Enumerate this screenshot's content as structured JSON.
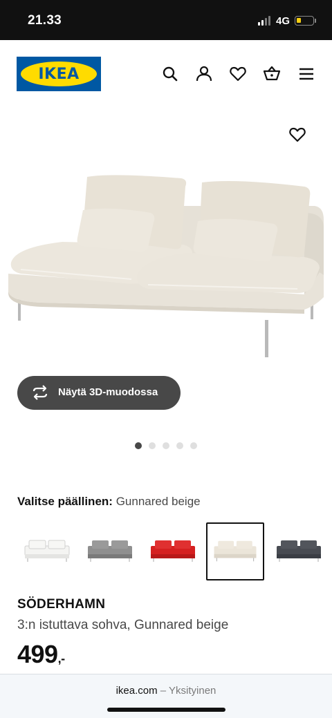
{
  "status_bar": {
    "time": "21.33",
    "network": "4G",
    "signal_icon": "signal-bars-icon",
    "battery_icon": "battery-low-icon",
    "battery_color": "#f7cf12"
  },
  "header": {
    "logo_text": "IKEA",
    "brand_blue": "#0058a3",
    "brand_yellow": "#ffdb00",
    "icons": [
      "search-icon",
      "account-icon",
      "heart-icon",
      "basket-icon",
      "menu-icon"
    ]
  },
  "product_gallery": {
    "image": "sofa-beige-photo",
    "wishlist_icon": "heart-icon",
    "view_3d_button": "Näytä 3D-muodossa",
    "view_3d_icon": "rotate-arrows-icon",
    "image_count": 5,
    "active_image": 1
  },
  "cover_selector": {
    "label": "Valitse päällinen:",
    "selected_value": "Gunnared beige",
    "swatches": [
      {
        "name": "white",
        "color": "#f2f2f0"
      },
      {
        "name": "grey",
        "color": "#8a8a8a"
      },
      {
        "name": "red",
        "color": "#d32020"
      },
      {
        "name": "beige",
        "color": "#e8e2d6"
      },
      {
        "name": "dark-grey",
        "color": "#454850"
      }
    ],
    "selected_index": 3
  },
  "product": {
    "name": "SÖDERHAMN",
    "description": "3:n istuttava sohva, Gunnared beige",
    "price": "499",
    "price_suffix": ",-"
  },
  "browser": {
    "domain": "ikea.com",
    "separator": "–",
    "mode": "Yksityinen"
  }
}
